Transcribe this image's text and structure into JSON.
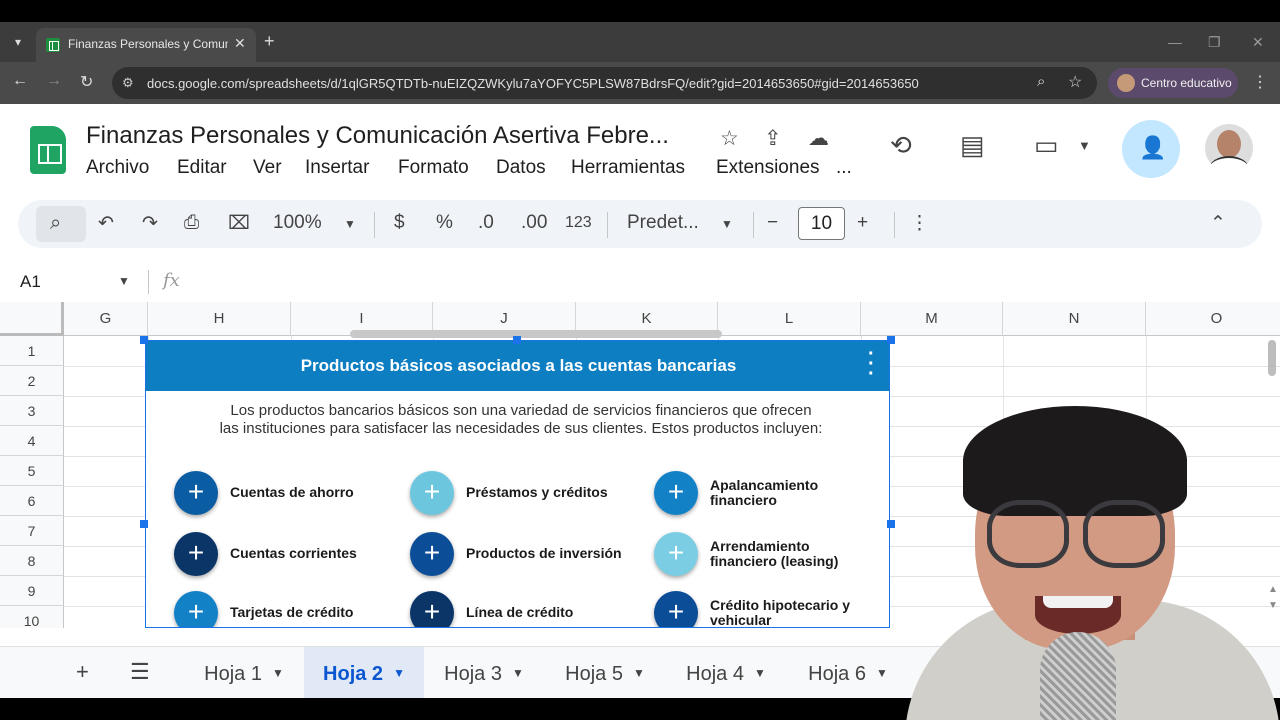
{
  "browser": {
    "tab_title": "Finanzas Personales y Comunic...",
    "url": "docs.google.com/spreadsheets/d/1qlGR5QTDTb-nuEIZQZWKylu7aYOFYC5PLSW87BdrsFQ/edit?gid=2014653650#gid=2014653650",
    "profile_name": "Centro educativo"
  },
  "doc": {
    "title": "Finanzas Personales y Comunicación Asertiva Febre...",
    "menu": [
      "Archivo",
      "Editar",
      "Ver",
      "Insertar",
      "Formato",
      "Datos",
      "Herramientas",
      "Extensiones",
      "..."
    ]
  },
  "toolbar": {
    "zoom": "100%",
    "currency": "$",
    "percent": "%",
    "decrease_decimals": ".0",
    "increase_decimals": ".00",
    "number_format": "123",
    "font": "Predet...",
    "font_size": "10",
    "minus": "−",
    "plus": "+"
  },
  "formula_bar": {
    "cell_ref": "A1",
    "fx": "fx"
  },
  "grid": {
    "columns": [
      "G",
      "H",
      "I",
      "J",
      "K",
      "L",
      "M",
      "N",
      "O"
    ],
    "rows": [
      "1",
      "2",
      "3",
      "4",
      "5",
      "6",
      "7",
      "8",
      "9",
      "10"
    ]
  },
  "embedded_image": {
    "title": "Productos básicos asociados a las cuentas bancarias",
    "intro_line1": "Los productos bancarios básicos son una variedad de servicios financieros que ofrecen",
    "intro_line2": "las instituciones para satisfacer las necesidades de sus clientes. Estos productos incluyen:",
    "products": [
      {
        "line1": "Cuentas de ahorro",
        "line2": "",
        "color": "#0b5da3"
      },
      {
        "line1": "Préstamos y créditos",
        "line2": "",
        "color": "#6cc7de"
      },
      {
        "line1": "Apalancamiento",
        "line2": "financiero",
        "color": "#1381c6"
      },
      {
        "line1": "Cuentas corrientes",
        "line2": "",
        "color": "#0a3566"
      },
      {
        "line1": "Productos de inversión",
        "line2": "",
        "color": "#0b4d96"
      },
      {
        "line1": "Arrendamiento",
        "line2": "financiero (leasing)",
        "color": "#7acde2"
      },
      {
        "line1": "Tarjetas de crédito",
        "line2": "",
        "color": "#1381c6"
      },
      {
        "line1": "Línea de crédito",
        "line2": "",
        "color": "#0a3566"
      },
      {
        "line1": "Crédito hipotecario y",
        "line2": "vehicular",
        "color": "#0b4d96"
      }
    ]
  },
  "sheet_tabs": [
    {
      "label": "Hoja 1",
      "active": false
    },
    {
      "label": "Hoja 2",
      "active": true
    },
    {
      "label": "Hoja 3",
      "active": false
    },
    {
      "label": "Hoja 5",
      "active": false
    },
    {
      "label": "Hoja 4",
      "active": false
    },
    {
      "label": "Hoja 6",
      "active": false
    }
  ],
  "colors": {
    "accent": "#0b57d0",
    "embed_header": "#0d7ec2",
    "sheets_green": "#1fa463"
  }
}
